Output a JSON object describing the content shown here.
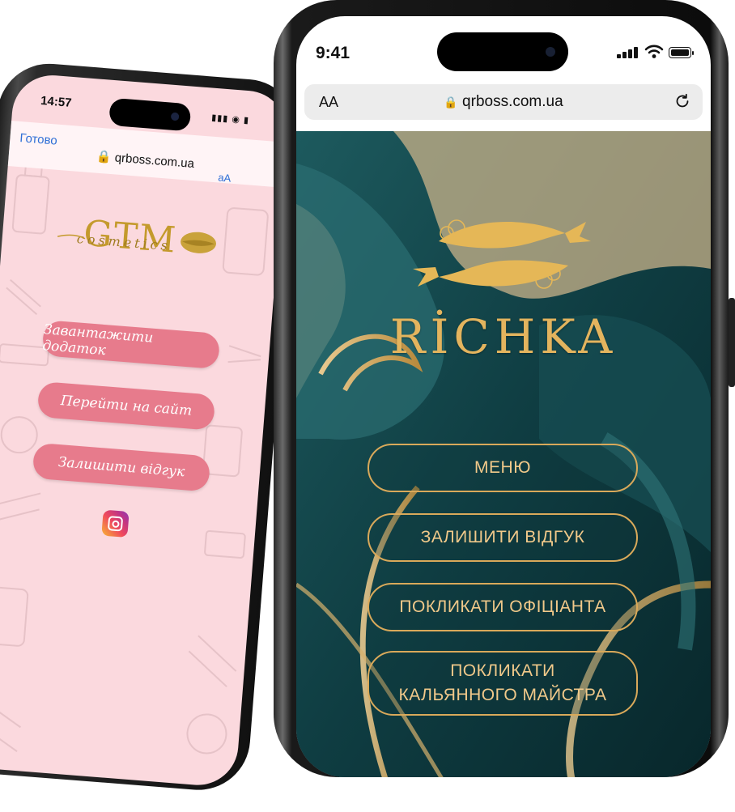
{
  "back_phone": {
    "time": "14:57",
    "status": "▮▮▮ ◉ ▮",
    "nav_done": "Готово",
    "url": "qrboss.com.ua",
    "text_size": "аА",
    "logo_text": "GTM",
    "logo_sub": "cosmetics",
    "buttons": [
      "Завантажити додаток",
      "Перейти на сайт",
      "Залишити відгук"
    ],
    "social_icon": "instagram-icon",
    "colors": {
      "background": "#fbd9de",
      "button": "#e77b8c",
      "logo_gold": "#c49a2c"
    }
  },
  "front_phone": {
    "time": "9:41",
    "text_size": "AA",
    "url": "qrboss.com.ua",
    "brand": "RİCHKA",
    "buttons": [
      "МЕНЮ",
      "ЗАЛИШИТИ ВІДГУК",
      "ПОКЛИКАТИ ОФІЦІАНТА",
      "ПОКЛИКАТИ\nКАЛЬЯННОГО МАЙСТРА"
    ],
    "colors": {
      "background": "#0f3b3f",
      "gold": "#d9a95a",
      "button_text": "#f1c98a"
    }
  }
}
